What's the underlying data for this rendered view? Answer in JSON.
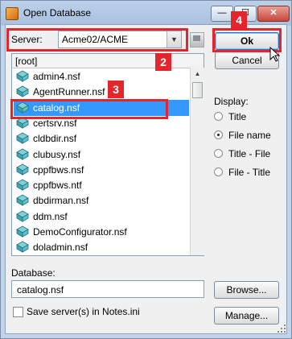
{
  "window": {
    "title": "Open Database",
    "min_glyph": "—",
    "max_glyph": "☐",
    "close_glyph": "✕"
  },
  "server": {
    "label": "Server:",
    "value": "Acme02/ACME",
    "dropdown_glyph": "▼"
  },
  "file_list": {
    "header": "[root]",
    "items": [
      {
        "label": "admin4.nsf",
        "selected": false
      },
      {
        "label": "AgentRunner.nsf",
        "selected": false
      },
      {
        "label": "catalog.nsf",
        "selected": true
      },
      {
        "label": "certsrv.nsf",
        "selected": false
      },
      {
        "label": "cldbdir.nsf",
        "selected": false
      },
      {
        "label": "clubusy.nsf",
        "selected": false
      },
      {
        "label": "cppfbws.nsf",
        "selected": false
      },
      {
        "label": "cppfbws.ntf",
        "selected": false
      },
      {
        "label": "dbdirman.nsf",
        "selected": false
      },
      {
        "label": "ddm.nsf",
        "selected": false
      },
      {
        "label": "DemoConfigurator.nsf",
        "selected": false
      },
      {
        "label": "doladmin.nsf",
        "selected": false
      }
    ],
    "item_icon": "database-book-icon",
    "scroll_up_glyph": "▲"
  },
  "buttons": {
    "ok": "Ok",
    "cancel": "Cancel",
    "browse": "Browse...",
    "manage": "Manage..."
  },
  "display": {
    "label": "Display:",
    "options": [
      {
        "label": "Title",
        "checked": false
      },
      {
        "label": "File name",
        "checked": true
      },
      {
        "label": "Title - File",
        "checked": false
      },
      {
        "label": "File - Title",
        "checked": false
      }
    ]
  },
  "database": {
    "label": "Database:",
    "value": "catalog.nsf"
  },
  "save_servers": {
    "label": "Save server(s) in Notes.ini",
    "checked": false
  },
  "callouts": [
    "2",
    "3",
    "4"
  ],
  "colors": {
    "callout": "#e4262c",
    "selection": "#3399ff"
  }
}
